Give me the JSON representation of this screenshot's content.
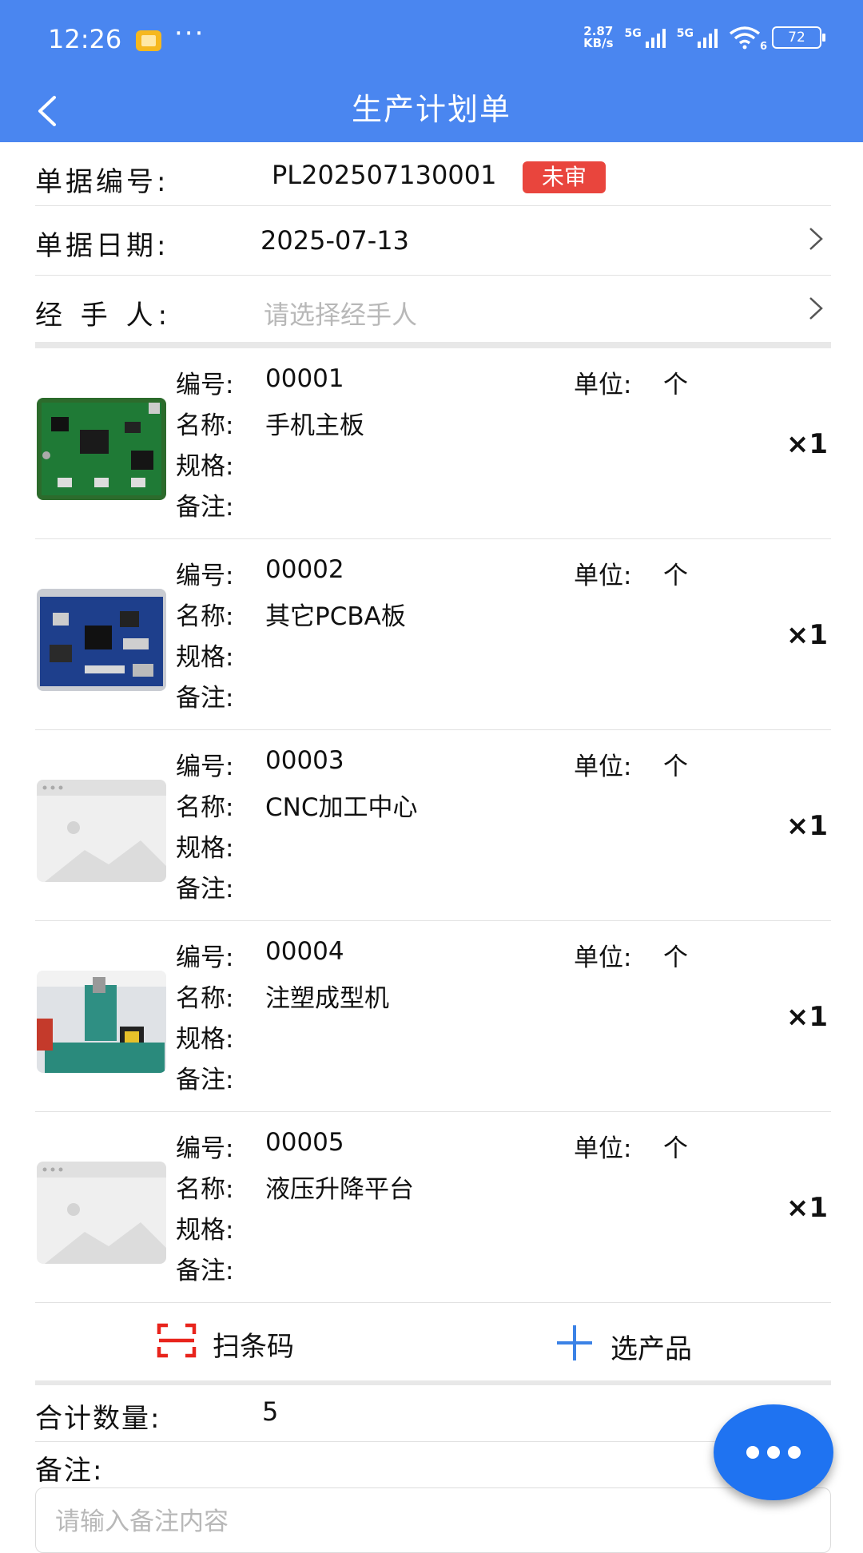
{
  "status_bar": {
    "time": "12:26",
    "more": "···",
    "net_speed_value": "2.87",
    "net_speed_unit": "KB/s",
    "sim1": "5G",
    "sim2": "5G",
    "wifi_sub": "6",
    "battery": "72"
  },
  "header": {
    "title": "生产计划单"
  },
  "form": {
    "doc_no_label": "单据编号:",
    "doc_no": "PL202507130001",
    "status_badge": "未审",
    "date_label": "单据日期:",
    "date": "2025-07-13",
    "handler_label": "经 手 人:",
    "handler_placeholder": "请选择经手人"
  },
  "item_labels": {
    "code": "编号:",
    "unit": "单位:",
    "name": "名称:",
    "spec": "规格:",
    "remark": "备注:"
  },
  "items": [
    {
      "code": "00001",
      "unit": "个",
      "name": "手机主板",
      "spec": "",
      "remark": "",
      "qty": "×1",
      "thumb": "pcb-green"
    },
    {
      "code": "00002",
      "unit": "个",
      "name": "其它PCBA板",
      "spec": "",
      "remark": "",
      "qty": "×1",
      "thumb": "pcb-blue"
    },
    {
      "code": "00003",
      "unit": "个",
      "name": "CNC加工中心",
      "spec": "",
      "remark": "",
      "qty": "×1",
      "thumb": "placeholder"
    },
    {
      "code": "00004",
      "unit": "个",
      "name": "注塑成型机",
      "spec": "",
      "remark": "",
      "qty": "×1",
      "thumb": "machine"
    },
    {
      "code": "00005",
      "unit": "个",
      "name": "液压升降平台",
      "spec": "",
      "remark": "",
      "qty": "×1",
      "thumb": "placeholder"
    }
  ],
  "actions": {
    "scan_label": "扫条码",
    "select_label": "选产品"
  },
  "summary": {
    "total_label": "合计数量:",
    "total_value": "5",
    "remark_label": "备注:",
    "remark_placeholder": "请输入备注内容"
  },
  "colors": {
    "header": "#4a86f0",
    "badge": "#e9453d",
    "fab": "#1f73f1",
    "scan_icon": "#e8241c",
    "add_icon": "#3b82e6"
  }
}
